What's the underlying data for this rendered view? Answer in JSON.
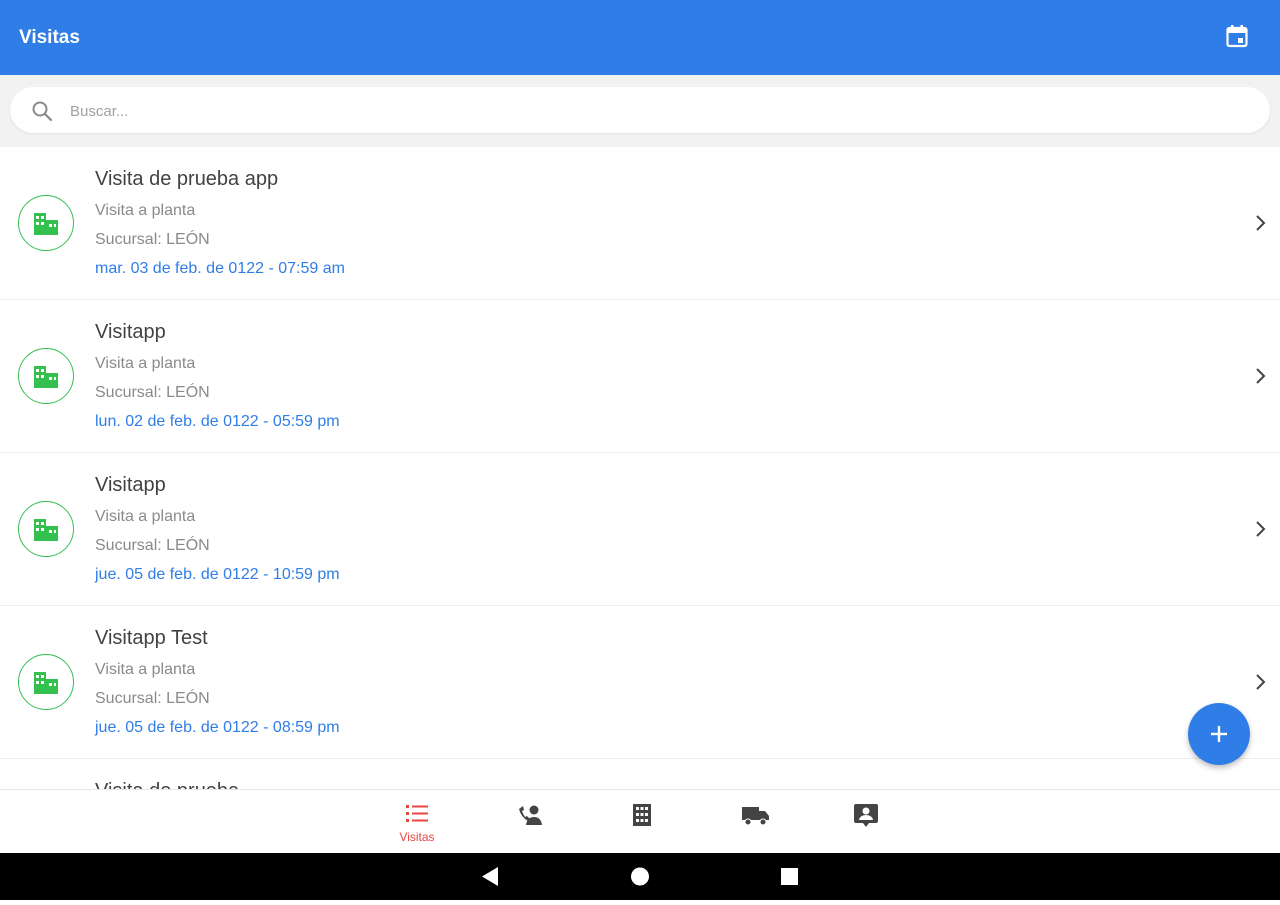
{
  "appbar": {
    "title": "Visitas",
    "action_icon": "calendar-icon"
  },
  "search": {
    "placeholder": "Buscar...",
    "value": ""
  },
  "colors": {
    "primary": "#2f7de6",
    "accent_green": "#34c04f",
    "active_tab": "#e8453c"
  },
  "visits": [
    {
      "title": "Visita de prueba app",
      "type": "Visita a planta",
      "branch": "Sucursal: LEÓN",
      "date": "mar. 03 de feb. de 0122 - 07:59 am"
    },
    {
      "title": "Visitapp",
      "type": "Visita a planta",
      "branch": "Sucursal: LEÓN",
      "date": "lun. 02 de feb. de 0122 - 05:59 pm"
    },
    {
      "title": "Visitapp",
      "type": "Visita a planta",
      "branch": "Sucursal: LEÓN",
      "date": "jue. 05 de feb. de 0122 - 10:59 pm"
    },
    {
      "title": "Visitapp Test",
      "type": "Visita a planta",
      "branch": "Sucursal: LEÓN",
      "date": "jue. 05 de feb. de 0122 - 08:59 pm"
    },
    {
      "title": "Visita de prueba",
      "type": "",
      "branch": "",
      "date": ""
    }
  ],
  "bottom_nav": [
    {
      "icon": "list-icon",
      "label": "Visitas",
      "active": true
    },
    {
      "icon": "person-phone-icon",
      "label": "",
      "active": false
    },
    {
      "icon": "building-icon",
      "label": "",
      "active": false
    },
    {
      "icon": "truck-icon",
      "label": "",
      "active": false
    },
    {
      "icon": "contact-card-icon",
      "label": "",
      "active": false
    }
  ]
}
